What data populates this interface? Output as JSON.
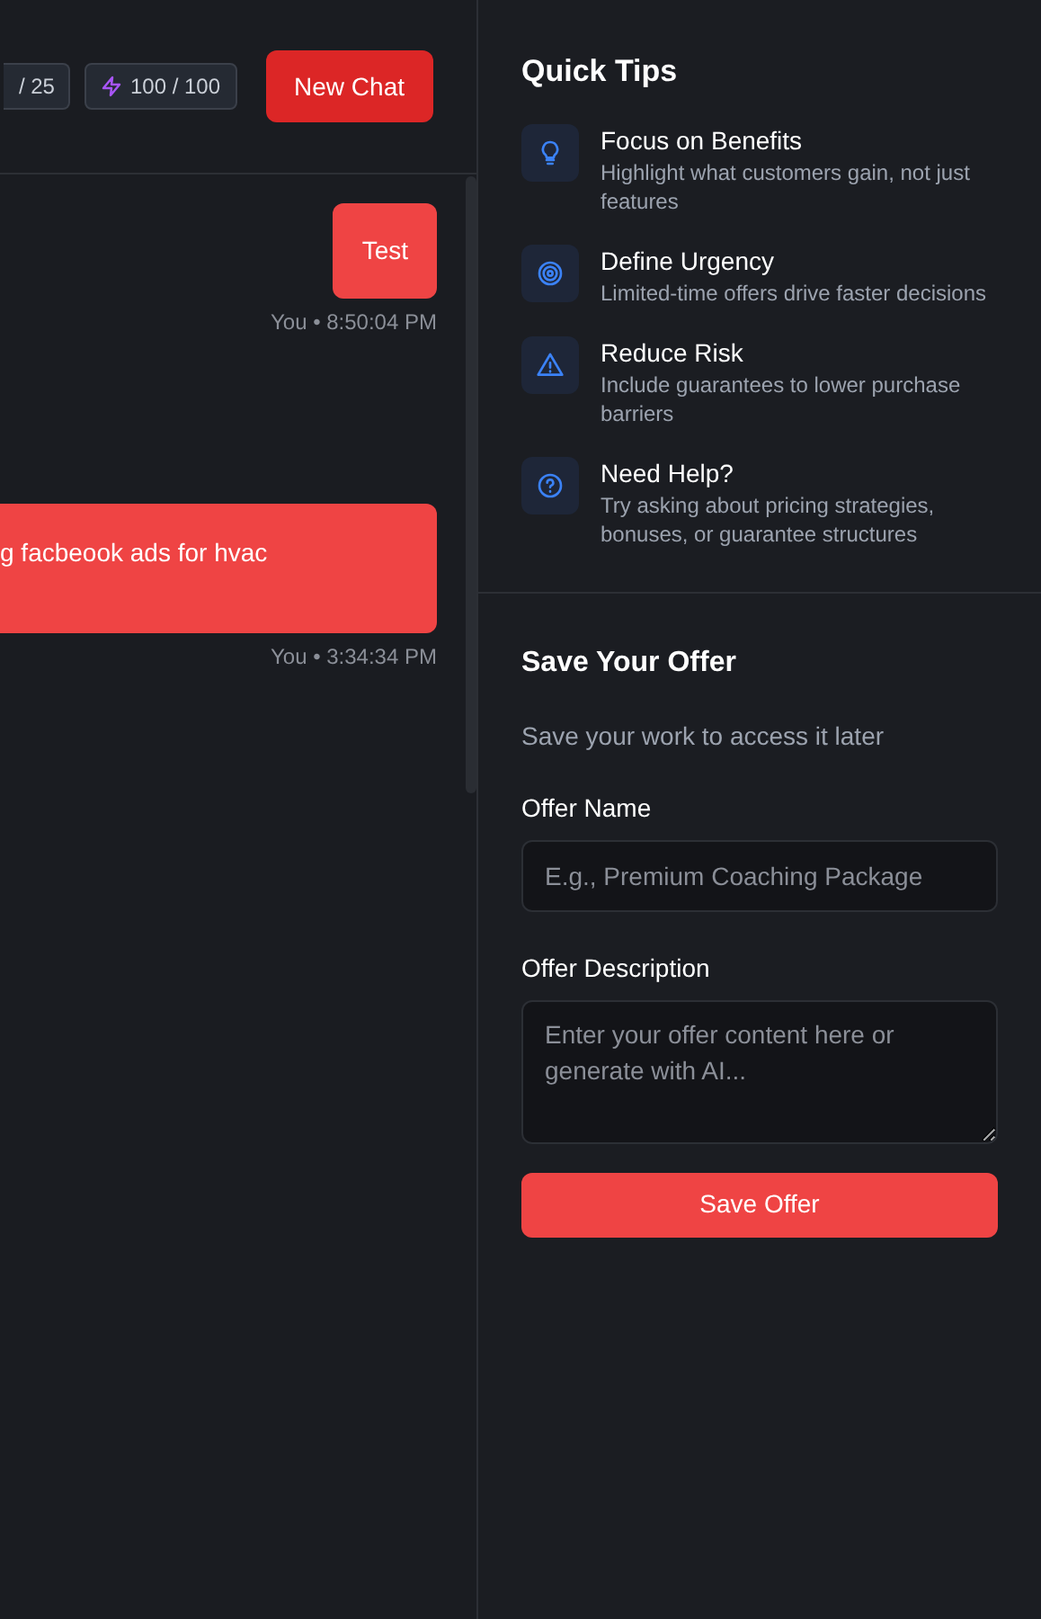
{
  "header": {
    "counters": [
      {
        "kind": "plain",
        "text": "/ 25"
      },
      {
        "kind": "bolt",
        "text": "100 / 100"
      }
    ],
    "new_chat_button": "New Chat"
  },
  "messages": [
    {
      "text": "Test",
      "meta": "You • 8:50:04 PM",
      "kind": "short"
    },
    {
      "text": "g facbeook ads for hvac",
      "meta": "You • 3:34:34 PM",
      "kind": "wide"
    }
  ],
  "quick_tips": {
    "title": "Quick Tips",
    "items": [
      {
        "kind": "bulb",
        "title": "Focus on Benefits",
        "text": "Highlight what customers gain, not just features"
      },
      {
        "kind": "target",
        "title": "Define Urgency",
        "text": "Limited-time offers drive faster decisions"
      },
      {
        "kind": "warning",
        "title": "Reduce Risk",
        "text": "Include guarantees to lower purchase barriers"
      },
      {
        "kind": "help",
        "title": "Need Help?",
        "text": "Try asking about pricing strategies, bonuses, or guarantee structures"
      }
    ]
  },
  "save_offer": {
    "title": "Save Your Offer",
    "subtitle": "Save your work to access it later",
    "name_label": "Offer Name",
    "name_placeholder": "E.g., Premium Coaching Package",
    "description_label": "Offer Description",
    "description_placeholder": "Enter your offer content here or generate with AI...",
    "button": "Save Offer"
  }
}
